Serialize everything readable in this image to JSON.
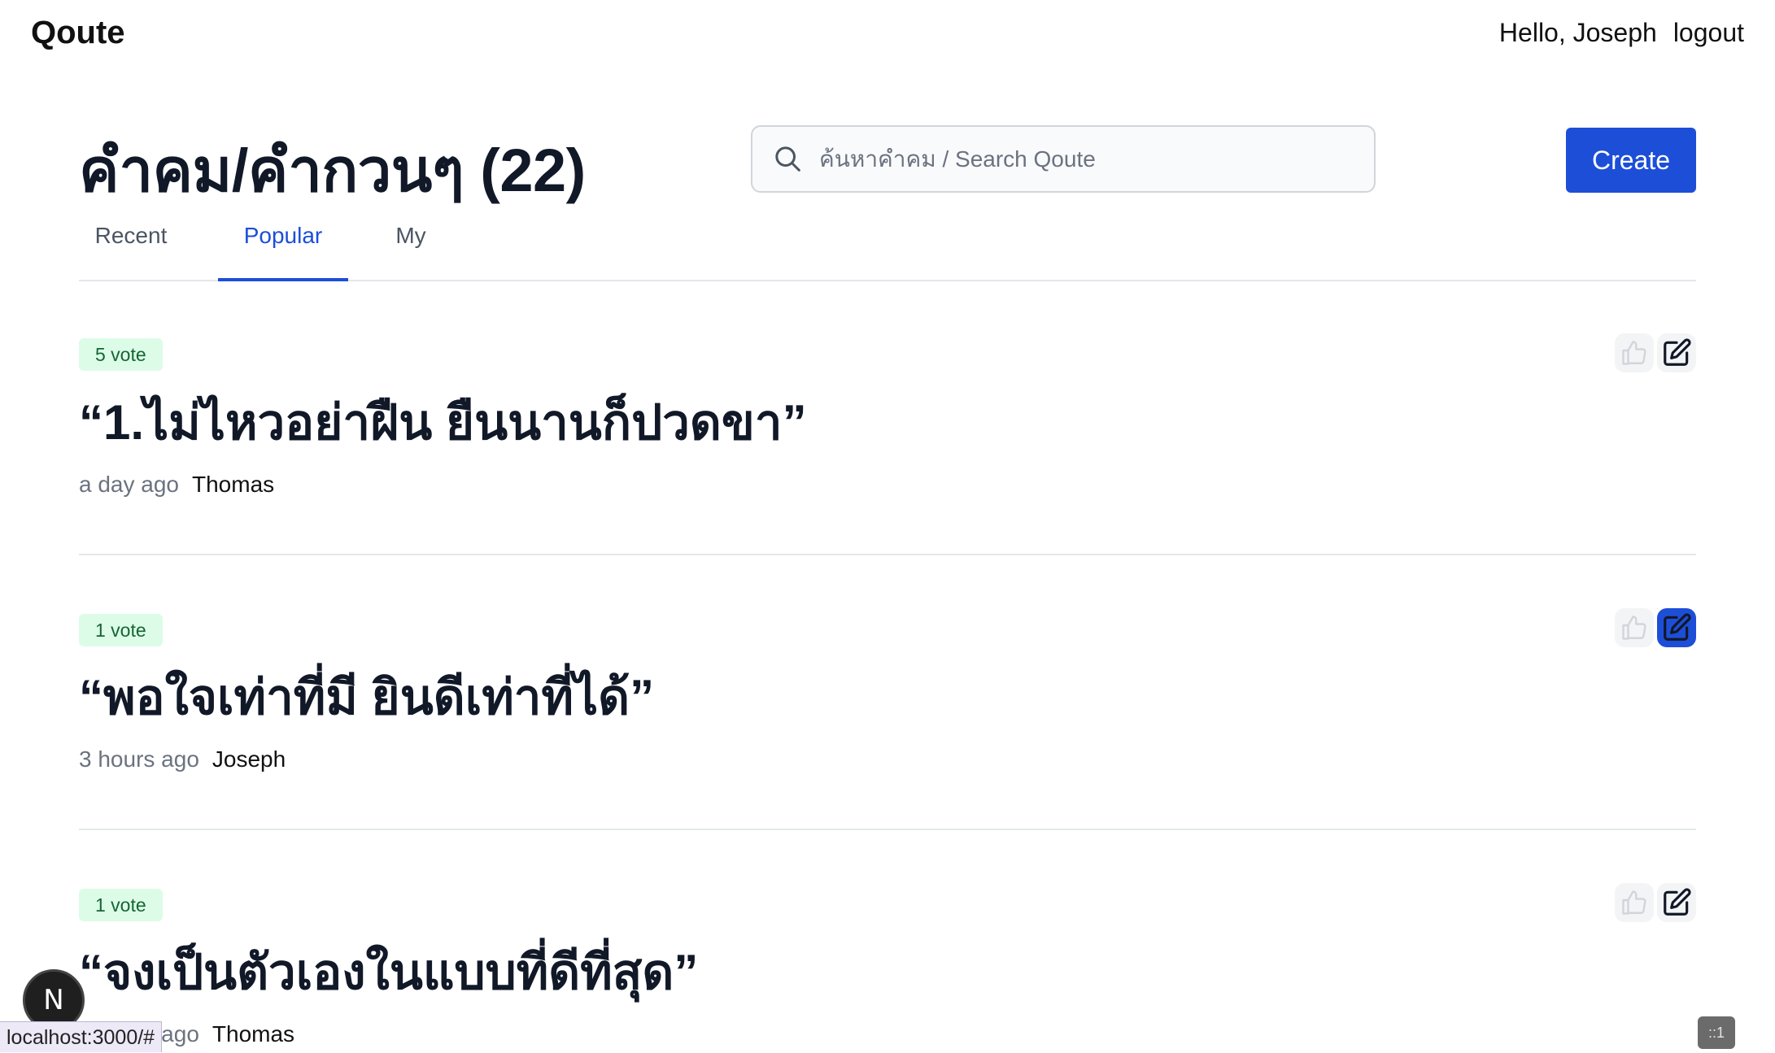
{
  "navbar": {
    "brand": "Qoute",
    "greeting": "Hello, Joseph",
    "logout": "logout"
  },
  "header": {
    "title": "คำคม/คำกวนๆ (22)",
    "search_placeholder": "ค้นหาคำคม / Search Qoute",
    "create_label": "Create"
  },
  "tabs": [
    {
      "label": "Recent",
      "active": false
    },
    {
      "label": "Popular",
      "active": true
    },
    {
      "label": "My",
      "active": false
    }
  ],
  "quotes": [
    {
      "votes": "5 vote",
      "text": "“1.ไม่ไหวอย่าฝืน ยืนนานก็ปวดขา”",
      "time": "a day ago",
      "author": "Thomas"
    },
    {
      "votes": "1 vote",
      "text": "“พอใจเท่าที่มี ยินดีเท่าที่ได้”",
      "time": "3 hours ago",
      "author": "Joseph"
    },
    {
      "votes": "1 vote",
      "text": "“จงเป็นตัวเองในแบบที่ดีที่สุด”",
      "time": "3 hours ago",
      "author": "Thomas"
    }
  ],
  "overlays": {
    "next_badge": "N",
    "status_url": "localhost:3000/#",
    "corner_indicator": "::1"
  },
  "colors": {
    "accent": "#1d4ed8",
    "vote_badge_bg": "#dcfce7",
    "vote_badge_text": "#166534"
  }
}
